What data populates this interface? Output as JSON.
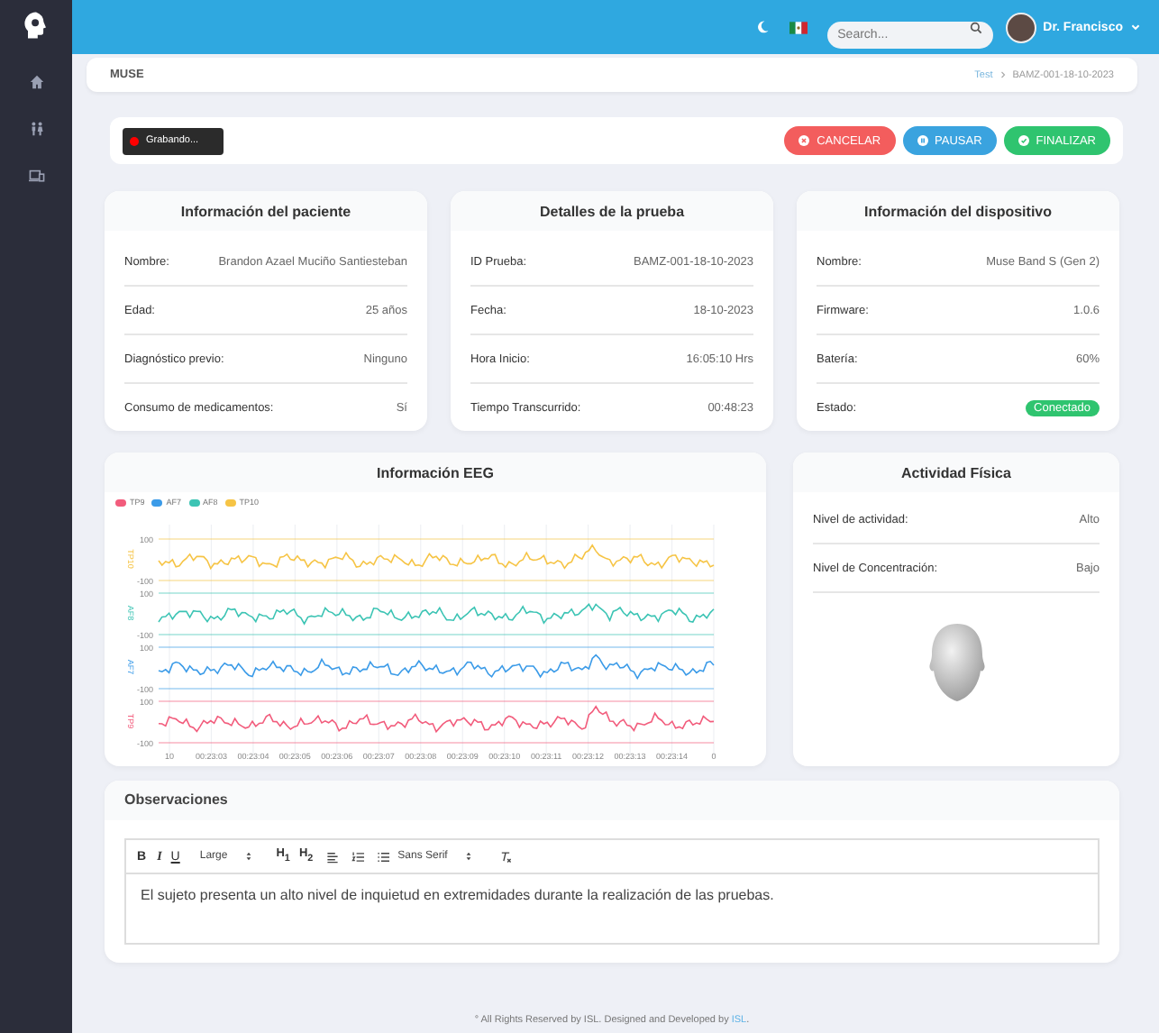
{
  "topbar": {
    "search": {
      "placeholder": "Search..."
    },
    "user": "Dr. Francisco"
  },
  "breadcrumb": {
    "title": "MUSE",
    "trail": [
      "Test",
      "BAMZ-001-18-10-2023"
    ]
  },
  "recording": {
    "label": "Grabando..."
  },
  "actions": [
    {
      "label": "CANCELAR",
      "kind": "cancel"
    },
    {
      "label": "PAUSAR",
      "kind": "pause"
    },
    {
      "label": "FINALIZAR",
      "kind": "finish"
    }
  ],
  "cards": [
    {
      "title": "Información del paciente",
      "rows": [
        {
          "label": "Nombre:",
          "value": "Brandon Azael Muciño Santiesteban",
          "kind": "text"
        },
        {
          "label": "Edad:",
          "value": "25 años",
          "kind": "text"
        },
        {
          "label": "Diagnóstico previo:",
          "value": "Ninguno",
          "kind": "text"
        },
        {
          "label": "Consumo de medicamentos:",
          "value": "Sí",
          "kind": "text"
        }
      ]
    },
    {
      "title": "Detalles de la prueba",
      "rows": [
        {
          "label": "ID Prueba:",
          "value": "BAMZ-001-18-10-2023",
          "kind": "text"
        },
        {
          "label": "Fecha:",
          "value": "18-10-2023",
          "kind": "text"
        },
        {
          "label": "Hora Inicio:",
          "value": "16:05:10 Hrs",
          "kind": "text"
        },
        {
          "label": "Tiempo Transcurrido:",
          "value": "00:48:23",
          "kind": "text"
        }
      ]
    },
    {
      "title": "Información del dispositivo",
      "rows": [
        {
          "label": "Nombre:",
          "value": "Muse Band S (Gen 2)",
          "kind": "text"
        },
        {
          "label": "Firmware:",
          "value": "1.0.6",
          "kind": "text"
        },
        {
          "label": "Batería:",
          "value": "60%",
          "kind": "text"
        },
        {
          "label": "Estado:",
          "value": "Conectado",
          "kind": "badge"
        }
      ]
    }
  ],
  "eeg": {
    "title": "Información EEG",
    "legend": [
      {
        "label": "TP9",
        "color": "#f25c7c"
      },
      {
        "label": "AF7",
        "color": "#3b9be8"
      },
      {
        "label": "AF8",
        "color": "#3cc4b4"
      },
      {
        "label": "TP10",
        "color": "#f6c445"
      }
    ],
    "channels": [
      {
        "name": "TP10",
        "color": "#f6c445",
        "ticks": [
          "100",
          "-100"
        ]
      },
      {
        "name": "AF8",
        "color": "#3cc4b4",
        "ticks": [
          "100",
          "-100"
        ]
      },
      {
        "name": "AF7",
        "color": "#3b9be8",
        "ticks": [
          "100",
          "-100"
        ]
      },
      {
        "name": "TP9",
        "color": "#f25c7c",
        "ticks": [
          "100",
          "-100"
        ]
      }
    ],
    "time_labels": [
      "10",
      "00:23:03",
      "00:23:04",
      "00:23:05",
      "00:23:06",
      "00:23:07",
      "00:23:08",
      "00:23:09",
      "00:23:10",
      "00:23:11",
      "00:23:12",
      "00:23:13",
      "00:23:14",
      "0"
    ]
  },
  "activity": {
    "title": "Actividad Física",
    "rows": [
      {
        "label": "Nivel de actividad:",
        "value": "Alto"
      },
      {
        "label": "Nivel de Concentración:",
        "value": "Bajo"
      }
    ]
  },
  "observations": {
    "title": "Observaciones",
    "toolbar": [
      {
        "kind": "bold",
        "label": "B"
      },
      {
        "kind": "italic",
        "label": "I"
      },
      {
        "kind": "underline",
        "label": "U"
      },
      {
        "kind": "select",
        "label": "Large"
      },
      {
        "kind": "heading",
        "label": "H$_{1}$"
      },
      {
        "kind": "heading",
        "label": "H$_{2}$"
      },
      {
        "kind": "align"
      },
      {
        "kind": "ordered"
      },
      {
        "kind": "bullet"
      },
      {
        "kind": "select",
        "label": "Sans Serif"
      },
      {
        "kind": "clear"
      }
    ],
    "text": "El sujeto presenta un alto nivel de inquietud en extremidades durante la realización de las pruebas."
  },
  "footer": {
    "text": "° All Rights Reserved by ISL. Designed and Developed by ",
    "link": "ISL",
    "suffix": "."
  }
}
